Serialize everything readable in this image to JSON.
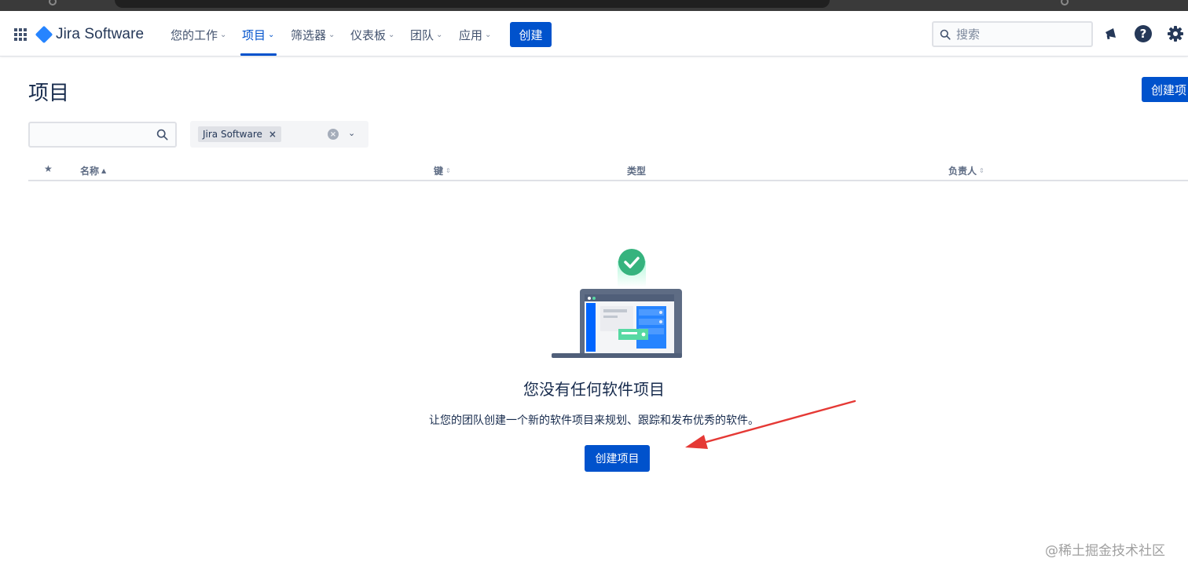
{
  "app": {
    "name": "Jira Software"
  },
  "nav": {
    "items": [
      {
        "label": "您的工作"
      },
      {
        "label": "项目"
      },
      {
        "label": "筛选器"
      },
      {
        "label": "仪表板"
      },
      {
        "label": "团队"
      },
      {
        "label": "应用"
      }
    ],
    "active_item": "项目",
    "create_label": "创建",
    "search_placeholder": "搜索"
  },
  "page": {
    "title": "项目",
    "create_project_label": "创建项目"
  },
  "filters": {
    "search_value": "",
    "product_chip": "Jira Software"
  },
  "table": {
    "columns": [
      "名称",
      "键",
      "类型",
      "负责人"
    ]
  },
  "empty_state": {
    "title": "您没有任何软件项目",
    "description": "让您的团队创建一个新的软件项目来规划、跟踪和发布优秀的软件。",
    "button_label": "创建项目"
  },
  "watermark": "@稀土掘金技术社区",
  "colors": {
    "brand_blue": "#0052cc",
    "logo_blue": "#2684ff",
    "success_green": "#36b37e",
    "annotation_red": "#e53935"
  }
}
